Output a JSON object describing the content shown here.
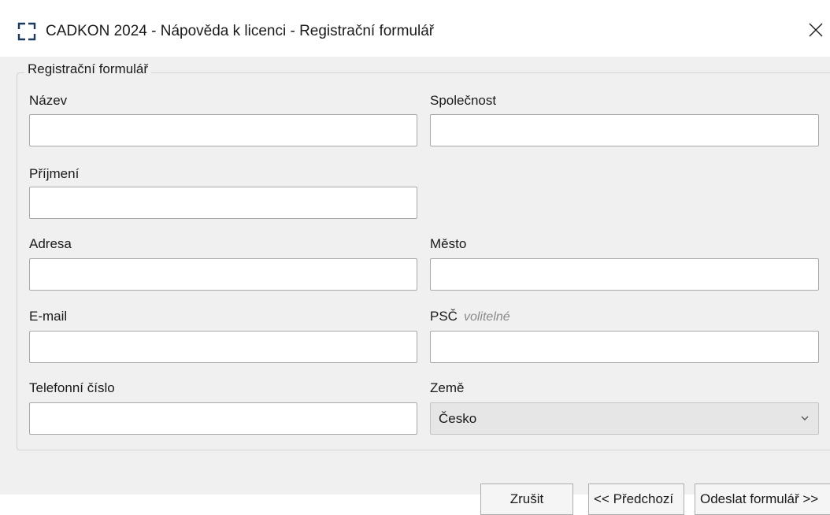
{
  "window": {
    "title": "CADKON 2024 - Nápověda k licenci - Registrační formulář",
    "logo_icon": "cadkon-logo-icon",
    "close_icon": "close-icon"
  },
  "form": {
    "group_title": "Registrační formulář",
    "fields": {
      "nazev": {
        "label": "Název",
        "value": ""
      },
      "spolecnost": {
        "label": "Společnost",
        "value": ""
      },
      "prijmeni": {
        "label": "Příjmení",
        "value": ""
      },
      "adresa": {
        "label": "Adresa",
        "value": ""
      },
      "mesto": {
        "label": "Město",
        "value": ""
      },
      "email": {
        "label": "E-mail",
        "value": ""
      },
      "psc": {
        "label": "PSČ",
        "optional_note": "volitelné",
        "value": ""
      },
      "telefon": {
        "label": "Telefonní číslo",
        "value": ""
      },
      "zeme": {
        "label": "Země",
        "selected": "Česko"
      }
    }
  },
  "buttons": {
    "cancel": "Zrušit",
    "previous": "<< Předchozí",
    "submit": "Odeslat formulář >>"
  },
  "colors": {
    "dialog_bg": "#f0f0f0",
    "titlebar_bg": "#ffffff",
    "input_border": "#a8a8a8",
    "logo_accent": "#1e3a5f"
  }
}
